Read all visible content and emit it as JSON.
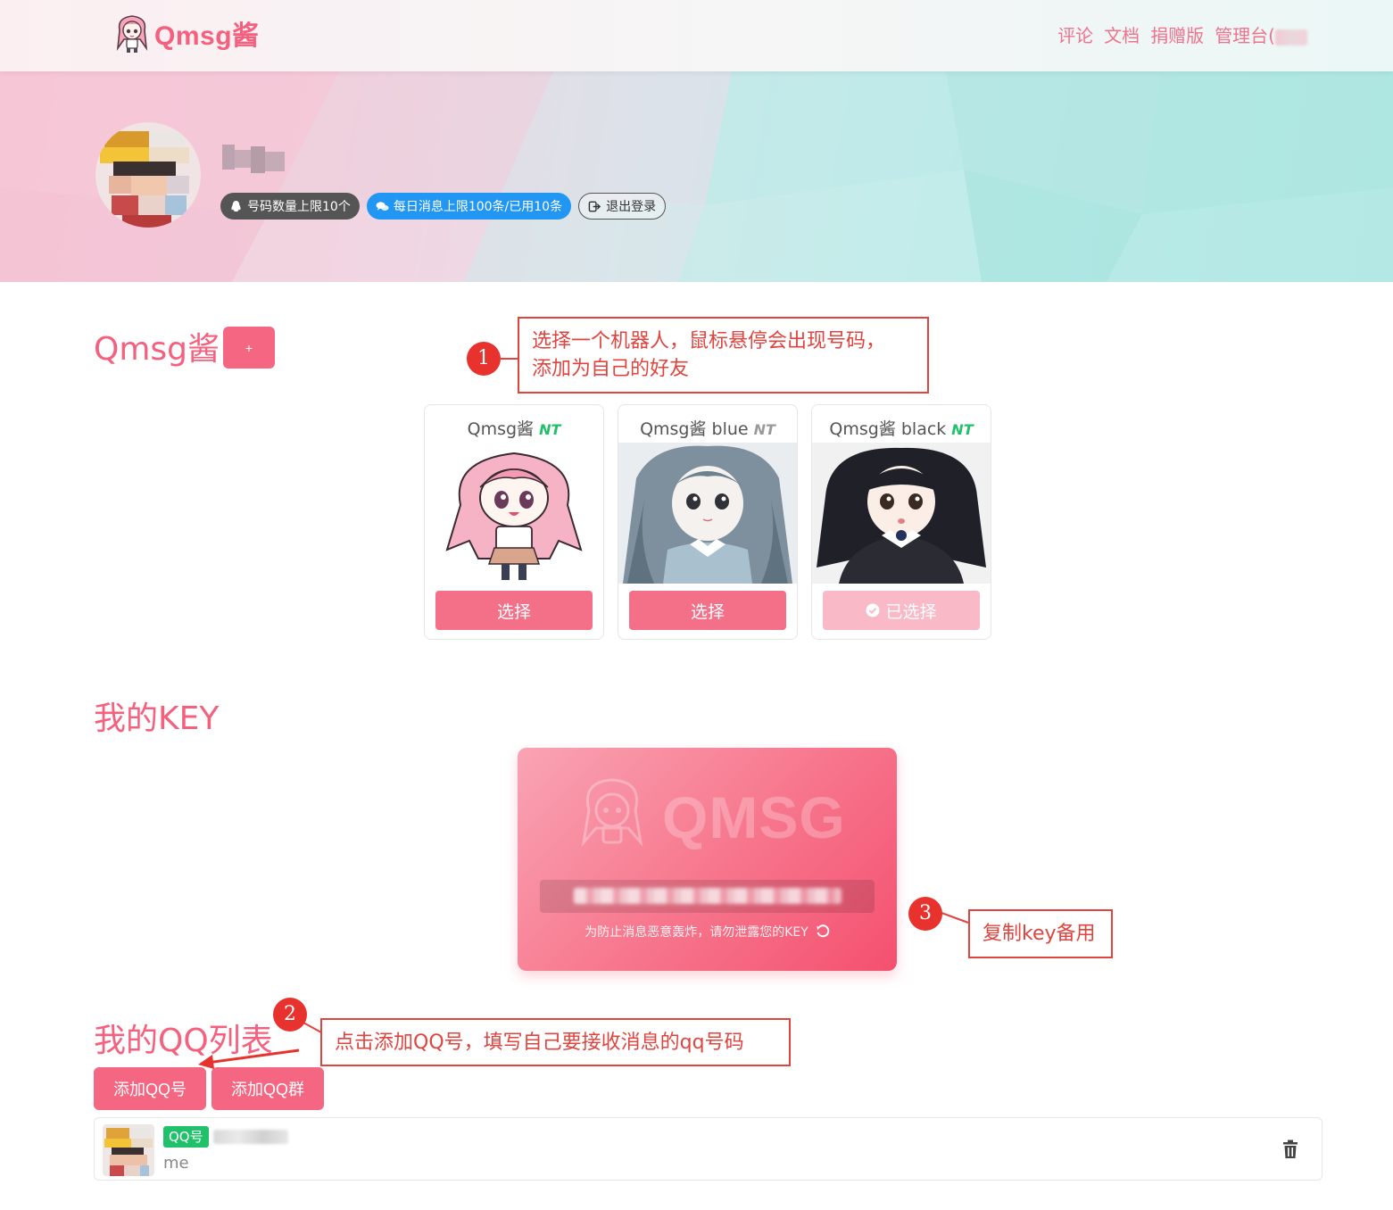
{
  "header": {
    "brand": "Qmsg酱",
    "nav": [
      "评论",
      "文档",
      "捐赠版",
      "管理台("
    ]
  },
  "profile": {
    "badges": {
      "quota": "号码数量上限10个",
      "messages": "每日消息上限100条/已用10条",
      "logout": "退出登录"
    }
  },
  "bots_section": {
    "title": "Qmsg酱",
    "add_label": "+",
    "bots": [
      {
        "name": "Qmsg酱",
        "tag": "NT",
        "button": "选择"
      },
      {
        "name": "Qmsg酱 blue",
        "tag": "NT",
        "button": "选择"
      },
      {
        "name": "Qmsg酱 black",
        "tag": "NT",
        "button": "已选择"
      }
    ]
  },
  "key_section": {
    "title": "我的KEY",
    "watermark": "QMSG",
    "note": "为防止消息恶意轰炸，请勿泄露您的KEY"
  },
  "qq_section": {
    "title": "我的QQ列表",
    "add_qq": "添加QQ号",
    "add_group": "添加QQ群",
    "items": [
      {
        "tag": "QQ号",
        "name": "me"
      }
    ]
  },
  "annotations": [
    {
      "num": "1",
      "line1": "选择一个机器人，鼠标悬停会出现号码，",
      "line2": "添加为自己的好友"
    },
    {
      "num": "2",
      "text": "点击添加QQ号，填写自己要接收消息的qq号码"
    },
    {
      "num": "3",
      "text": "复制key备用"
    }
  ],
  "colors": {
    "accent": "#f46681",
    "title_pink": "#f5607e",
    "nt_green": "#21c06b",
    "blue_badge": "#2196f3",
    "annotation_red": "#e0443e"
  },
  "icons": [
    "qq-penguin-icon",
    "chat-bubbles-icon",
    "logout-icon",
    "check-circle-icon",
    "refresh-icon",
    "trash-icon"
  ]
}
